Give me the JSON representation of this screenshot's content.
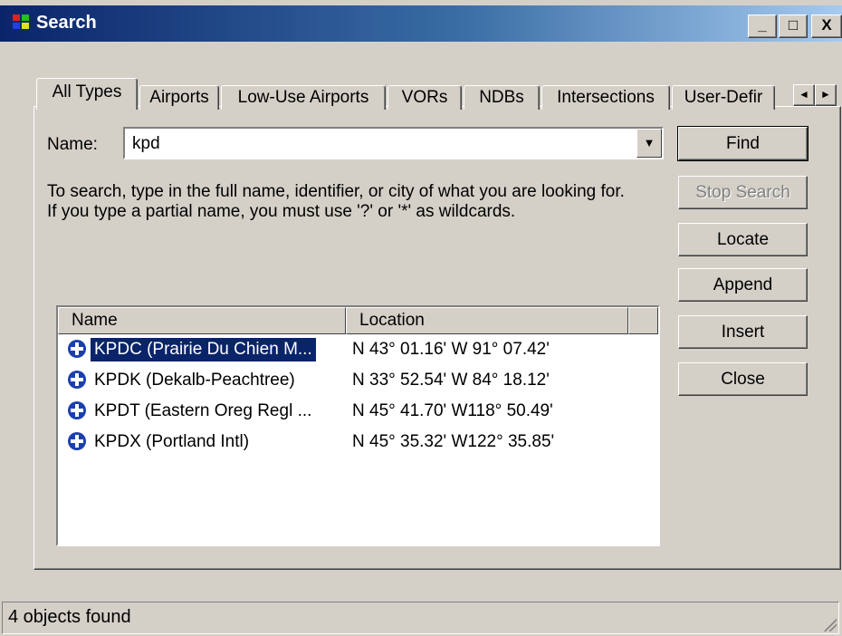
{
  "window": {
    "title": "Search",
    "controls": {
      "minimize": "_",
      "maximize": "□",
      "close": "X"
    }
  },
  "tabs": [
    {
      "label": "All Types",
      "active": true
    },
    {
      "label": "Airports"
    },
    {
      "label": "Low-Use Airports"
    },
    {
      "label": "VORs"
    },
    {
      "label": "NDBs"
    },
    {
      "label": "Intersections"
    },
    {
      "label": "User-Defir"
    }
  ],
  "tab_scroll": {
    "left": "◄",
    "right": "►"
  },
  "search": {
    "name_label": "Name:",
    "value": "kpd",
    "help_text": "To search, type in the full name, identifier, or city of what you are looking for.  If you type a partial name, you must use '?' or '*' as wildcards."
  },
  "buttons": {
    "find": "Find",
    "stop_search": "Stop Search",
    "locate": "Locate",
    "append": "Append",
    "insert": "Insert",
    "close": "Close"
  },
  "results": {
    "columns": [
      "Name",
      "Location"
    ],
    "icon": "airport-icon",
    "rows": [
      {
        "name": "KPDC (Prairie Du Chien M...",
        "location": "N 43° 01.16'  W 91° 07.42'",
        "selected": true
      },
      {
        "name": "KPDK (Dekalb-Peachtree)",
        "location": "N 33° 52.54'  W 84° 18.12'"
      },
      {
        "name": "KPDT (Eastern Oreg Regl ...",
        "location": "N 45° 41.70'  W118° 50.49'"
      },
      {
        "name": "KPDX (Portland Intl)",
        "location": "N 45° 35.32'  W122° 35.85'"
      }
    ]
  },
  "status": {
    "text": "4 objects found"
  },
  "colors": {
    "titlebar_start": "#0a246a",
    "titlebar_end": "#a6caf0",
    "selection": "#0a246a",
    "face": "#d4d0c8"
  }
}
